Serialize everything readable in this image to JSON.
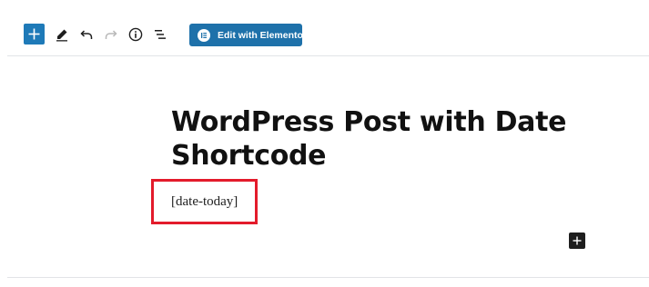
{
  "toolbar": {
    "add_block_icon": "plus-icon",
    "tools_icon": "pencil-icon",
    "undo_icon": "undo-icon",
    "redo_icon": "redo-icon",
    "info_icon": "info-icon",
    "outline_icon": "list-view-icon",
    "elementor_button_label": "Edit with Elementor",
    "elementor_icon": "elementor-logo-icon"
  },
  "editor": {
    "post_title": "WordPress Post with Date Shortcode",
    "shortcode_text": "[date-today]",
    "inserter_icon": "plus-icon"
  },
  "colors": {
    "primary_button": "#1e71aa",
    "add_button": "#1e7ab8",
    "highlight_border": "#e31b2b",
    "text": "#111111"
  }
}
